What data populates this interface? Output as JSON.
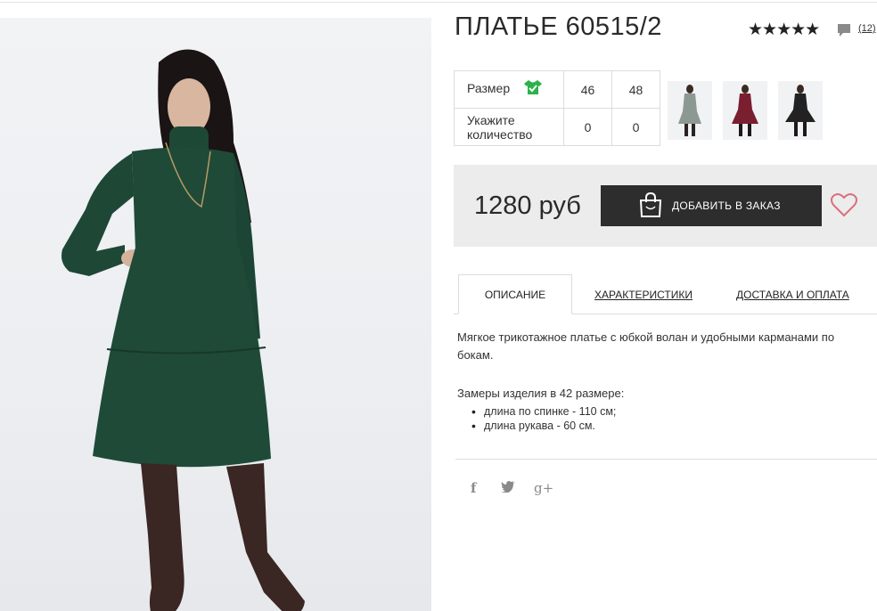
{
  "product": {
    "title": "ПЛАТЬЕ 60515/2",
    "stars": "★★★★★",
    "reviews_count": "(12)",
    "price": "1280 руб"
  },
  "sizes": {
    "size_label": "Размер",
    "qty_label": "Укажите количество",
    "columns": [
      "46",
      "48"
    ],
    "quantities": [
      "0",
      "0"
    ]
  },
  "buttons": {
    "add_to_order": "ДОБАВИТЬ В ЗАКАЗ"
  },
  "tabs": [
    {
      "label": "ОПИСАНИЕ"
    },
    {
      "label": "ХАРАКТЕРИСТИКИ"
    },
    {
      "label": "ДОСТАВКА И ОПЛАТА"
    }
  ],
  "description": {
    "text": "Мягкое трикотажное платье с юбкой волан и удобными карманами по бокам.",
    "measurements_title": "Замеры изделия в 42 размере:",
    "measurements": [
      "длина по спинке - 110 см;",
      "длина рукава - 60 см."
    ]
  },
  "social": {
    "facebook": "f",
    "twitter": "🐦",
    "googleplus": "g+"
  },
  "colors": {
    "dress_green": "#1f4a38",
    "thumb_grey": "#8c9993",
    "thumb_burgundy": "#7a1f30",
    "thumb_black": "#222222",
    "button_dark": "#2d2d2d",
    "heart": "#d9707c",
    "check_green": "#2cb24a"
  },
  "icons": [
    "review-bubble-icon",
    "shirt-check-icon",
    "shopping-bag-icon",
    "heart-icon",
    "facebook-icon",
    "twitter-icon",
    "google-plus-icon"
  ]
}
